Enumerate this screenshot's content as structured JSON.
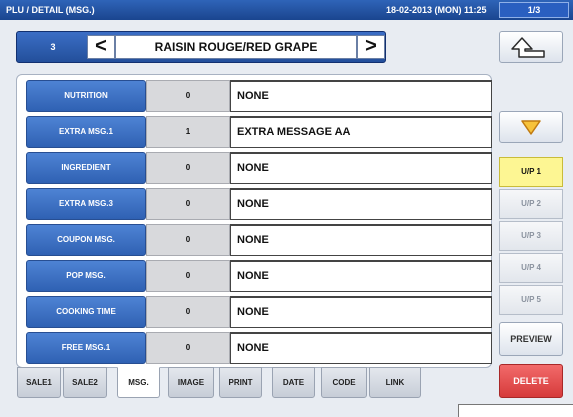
{
  "window": {
    "title": "PLU / DETAIL (MSG.)",
    "datetime": "18-02-2013 (MON) 11:25",
    "page_indicator": "1/3"
  },
  "nav": {
    "plu_number": "3",
    "prev_symbol": "<",
    "item_name": "RAISIN ROUGE/RED GRAPE",
    "next_symbol": ">"
  },
  "rows": [
    {
      "label": "NUTRITION",
      "count": "0",
      "value": "NONE"
    },
    {
      "label": "EXTRA MSG.1",
      "count": "1",
      "value": "EXTRA MESSAGE AA"
    },
    {
      "label": "INGREDIENT",
      "count": "0",
      "value": "NONE"
    },
    {
      "label": "EXTRA MSG.3",
      "count": "0",
      "value": "NONE"
    },
    {
      "label": "COUPON MSG.",
      "count": "0",
      "value": "NONE"
    },
    {
      "label": "POP MSG.",
      "count": "0",
      "value": "NONE"
    },
    {
      "label": "COOKING TIME",
      "count": "0",
      "value": "NONE"
    },
    {
      "label": "FREE MSG.1",
      "count": "0",
      "value": "NONE"
    }
  ],
  "tabs": [
    {
      "label": "SALE1",
      "active": false
    },
    {
      "label": "SALE2",
      "active": false
    },
    {
      "label": "MSG.",
      "active": true
    },
    {
      "label": "IMAGE",
      "active": false
    },
    {
      "label": "PRINT",
      "active": false
    },
    {
      "label": "DATE",
      "active": false
    },
    {
      "label": "CODE",
      "active": false
    },
    {
      "label": "LINK",
      "active": false
    }
  ],
  "side": {
    "return_icon": "return-arrow-icon",
    "down_icon": "triangle-down-icon",
    "up_pages": [
      {
        "label": "U/P 1",
        "active": true
      },
      {
        "label": "U/P 2",
        "active": false
      },
      {
        "label": "U/P 3",
        "active": false
      },
      {
        "label": "U/P 4",
        "active": false
      },
      {
        "label": "U/P 5",
        "active": false
      }
    ],
    "preview_label": "PREVIEW",
    "delete_label": "DELETE"
  },
  "colors": {
    "title_bar": "#1f4f9e",
    "row_label": "#3a6fc4",
    "active_up_page": "#fdf693",
    "delete_button": "#e04848",
    "down_arrow": "#f2a81c"
  }
}
